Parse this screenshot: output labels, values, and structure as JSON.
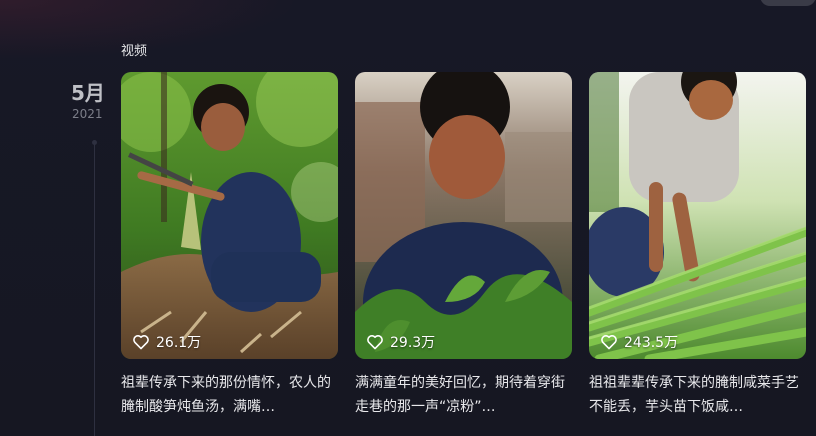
{
  "section": {
    "label": "视频"
  },
  "date": {
    "month": "5月",
    "year": "2021"
  },
  "videos": [
    {
      "likes": "26.1万",
      "caption": "祖辈传承下来的那份情怀，农人的腌制酸笋炖鱼汤，满嘴…"
    },
    {
      "likes": "29.3万",
      "caption": "满满童年的美好回忆，期待着穿街走巷的那一声“凉粉”…"
    },
    {
      "likes": "243.5万",
      "caption": "祖祖辈辈传承下来的腌制咸菜手艺不能丢，芋头苗下饭咸…"
    }
  ],
  "icons": {
    "like": "heart-outline-icon"
  },
  "colors": {
    "background": "#161722",
    "text": "#e8e8eb",
    "muted": "#7c7e89"
  }
}
